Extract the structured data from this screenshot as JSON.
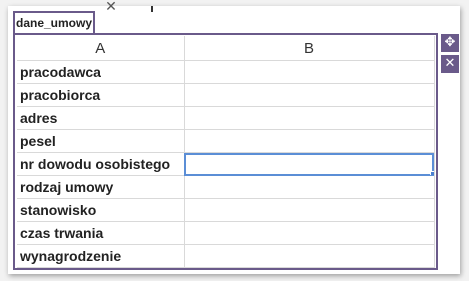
{
  "sheet": {
    "tab_name": "dane_umowy",
    "columns": [
      "A",
      "B"
    ],
    "rows": [
      {
        "a": "pracodawca",
        "b": ""
      },
      {
        "a": "pracobiorca",
        "b": ""
      },
      {
        "a": "adres",
        "b": ""
      },
      {
        "a": "pesel",
        "b": ""
      },
      {
        "a": "nr dowodu osobistego",
        "b": ""
      },
      {
        "a": "rodzaj umowy",
        "b": ""
      },
      {
        "a": "stanowisko",
        "b": ""
      },
      {
        "a": "czas trwania",
        "b": ""
      },
      {
        "a": "wynagrodzenie",
        "b": ""
      }
    ],
    "selected_row": 4
  },
  "icons": {
    "move": "move-arrows-icon",
    "close": "close-icon",
    "top_close": "close-icon"
  },
  "colors": {
    "frame": "#6a5a8a",
    "selection": "#5b8ed6"
  }
}
